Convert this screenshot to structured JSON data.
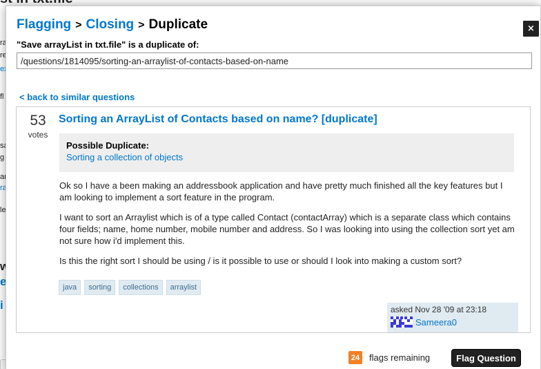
{
  "background": {
    "title_fragment": "st in txt.file"
  },
  "modal": {
    "close_label": "×",
    "breadcrumb": {
      "flagging": "Flagging",
      "closing": "Closing",
      "current": "Duplicate",
      "separator": ">"
    },
    "duplicate_of_label": "\"Save arrayList in txt.file\" is a duplicate of:",
    "url_value": "/questions/1814095/sorting-an-arraylist-of-contacts-based-on-name",
    "back_link": "< back to similar questions",
    "question": {
      "votes": "53",
      "votes_label": "votes",
      "title": "Sorting an ArrayList of Contacts based on name? [duplicate]",
      "possible_duplicate_heading": "Possible Duplicate:",
      "possible_duplicate_link": "Sorting a collection of objects",
      "paragraphs": [
        "Ok so I have a been making an addressbook application and have pretty much finished all the key features but I am looking to implement a sort feature in the program.",
        "I want to sort an Arraylist which is of a type called Contact (contactArray) which is a separate class which contains four fields; name, home number, mobile number and address. So I was looking into using the collection sort yet am not sure how i'd implement this.",
        "Is this the right sort I should be using / is it possible to use or should I look into making a custom sort?"
      ],
      "tags": [
        "java",
        "sorting",
        "collections",
        "arraylist"
      ],
      "asked": "asked Nov 28 '09 at 23:18",
      "user": "Sameera0"
    },
    "flags_count": "24",
    "flags_remaining_label": "flags remaining",
    "flag_button": "Flag Question"
  },
  "colors": {
    "link": "#0077cc",
    "tag_bg": "#e0eaf1",
    "badge": "#f48024",
    "button": "#222222"
  }
}
